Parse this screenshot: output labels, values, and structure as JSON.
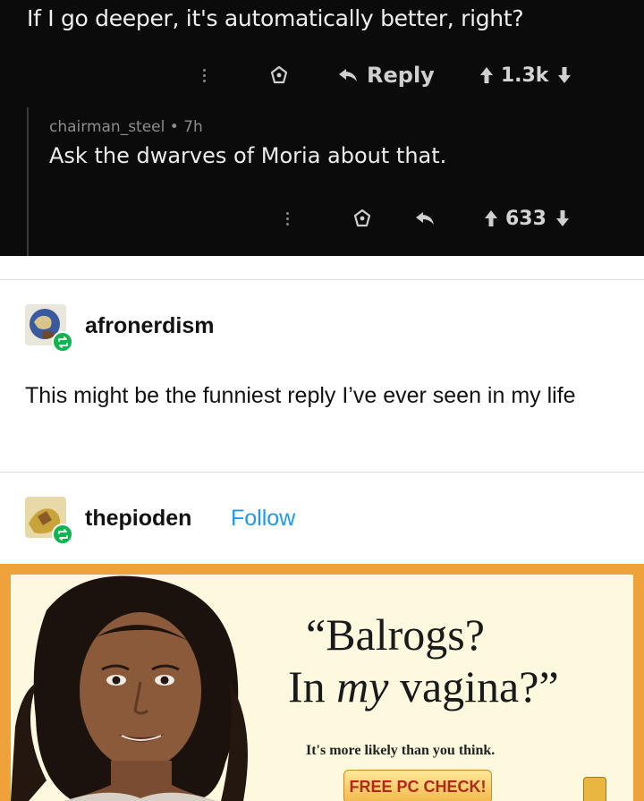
{
  "reddit": {
    "question": "If I go deeper, it's automatically better, right?",
    "post_actions": {
      "reply_label": "Reply",
      "score": "1.3k"
    },
    "comment": {
      "meta": "chairman_steel • 7h",
      "body": "Ask the dwarves of Moria about that.",
      "score": "633"
    }
  },
  "tumblr": {
    "reblog1": {
      "username": "afronerdism",
      "text": "This might be the funniest reply I’ve ever seen in my life"
    },
    "reblog2": {
      "username": "thepioden",
      "follow_label": "Follow"
    }
  },
  "ad": {
    "quote_line1": "“Balrogs?",
    "quote_line2_pre": "In ",
    "quote_line2_em": "my",
    "quote_line2_post": " vagina?”",
    "tagline": "It's more likely than you think.",
    "cta_label": "FREE PC CHECK!"
  },
  "colors": {
    "reddit_bg": "#0b0b0c",
    "follow": "#1e98f0",
    "reblog_badge": "#12b351",
    "ad_frame": "#f0a23a",
    "ad_bg": "#fdf9df"
  }
}
